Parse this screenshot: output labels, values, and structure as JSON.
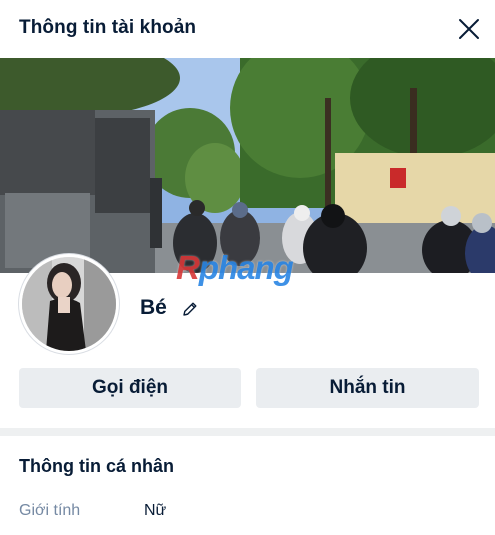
{
  "header": {
    "title": "Thông tin tài khoản",
    "close_icon": "close-icon"
  },
  "cover": {
    "description_icon": "street-photo",
    "watermark_first": "R",
    "watermark_rest": "phang"
  },
  "profile": {
    "name": "Bé",
    "edit_icon": "pencil-icon"
  },
  "actions": {
    "call_label": "Gọi điện",
    "message_label": "Nhắn tin"
  },
  "personal_info": {
    "title": "Thông tin cá nhân",
    "fields": [
      {
        "label": "Giới tính",
        "value": "Nữ"
      }
    ]
  },
  "colors": {
    "text": "#081c36",
    "muted": "#7589a3",
    "button_bg": "#eaedf0",
    "separator": "#eef0f1"
  }
}
